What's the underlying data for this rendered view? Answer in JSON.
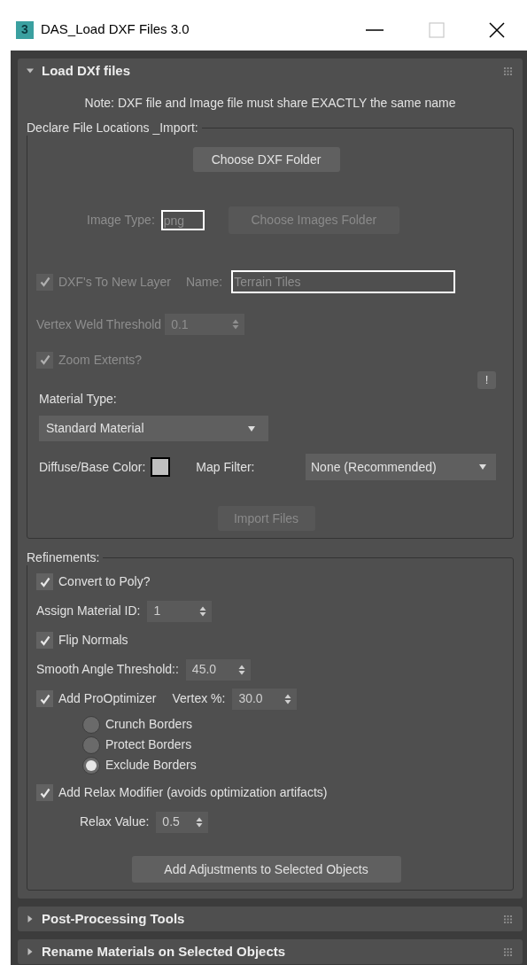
{
  "window": {
    "icon_text": "3",
    "title": "DAS_Load DXF Files 3.0"
  },
  "rollouts": [
    {
      "title": "Load DXf files",
      "expanded": true
    },
    {
      "title": "Post-Processing Tools",
      "expanded": false
    },
    {
      "title": "Rename Materials on Selected Objects",
      "expanded": false
    }
  ],
  "load": {
    "note": "Note: DXF file and Image file must share EXACTLY the same name",
    "group_title": "Declare File Locations _Import:",
    "choose_dxf_button": {
      "label": "Choose DXF Folder",
      "disabled": false
    },
    "image_type": {
      "label": "Image Type:",
      "value": "png",
      "disabled": true
    },
    "choose_images_button": {
      "label": "Choose Images Folder",
      "disabled": true
    },
    "new_layer": {
      "label": "DXF's To New Layer",
      "checked": true,
      "disabled": true
    },
    "layer_name": {
      "label": "Name:",
      "value": "Terrain Tiles",
      "disabled": true
    },
    "weld": {
      "label": "Vertex Weld Threshold",
      "value": "0.1",
      "disabled": true
    },
    "zoom_extents": {
      "label": "Zoom Extents?",
      "checked": true,
      "disabled": true
    },
    "info_button": {
      "label": "!"
    },
    "material_type": {
      "label": "Material Type:",
      "value": "Standard Material"
    },
    "diffuse": {
      "label": "Diffuse/Base Color:"
    },
    "map_filter": {
      "label": "Map Filter:",
      "value": "None (Recommended)"
    },
    "import_button": {
      "label": "Import Files",
      "disabled": true
    }
  },
  "refinements": {
    "group_title": "Refinements:",
    "rows": [
      {
        "kind": "checkbox",
        "label": "Convert to Poly?",
        "checked": true
      },
      {
        "kind": "spinner",
        "label": "Assign Material ID:",
        "value": "1"
      },
      {
        "kind": "checkbox",
        "label": "Flip Normals",
        "checked": true
      },
      {
        "kind": "spinner",
        "label": "Smooth Angle Threshold::",
        "value": "45.0"
      },
      {
        "kind": "checkspinner",
        "label": "Add ProOptimizer",
        "checked": true,
        "spinner_label": "Vertex %:",
        "value": "30.0"
      },
      {
        "kind": "radios",
        "options": [
          {
            "label": "Crunch Borders",
            "selected": false
          },
          {
            "label": "Protect Borders",
            "selected": false
          },
          {
            "label": "Exclude Borders",
            "selected": true
          }
        ]
      },
      {
        "kind": "checkbox",
        "label": "Add Relax Modifier (avoids optimization artifacts)",
        "checked": true
      },
      {
        "kind": "subspinner",
        "label": "Relax Value:",
        "value": "0.5"
      },
      {
        "kind": "button",
        "label": "Add Adjustments to Selected Objects"
      }
    ]
  }
}
